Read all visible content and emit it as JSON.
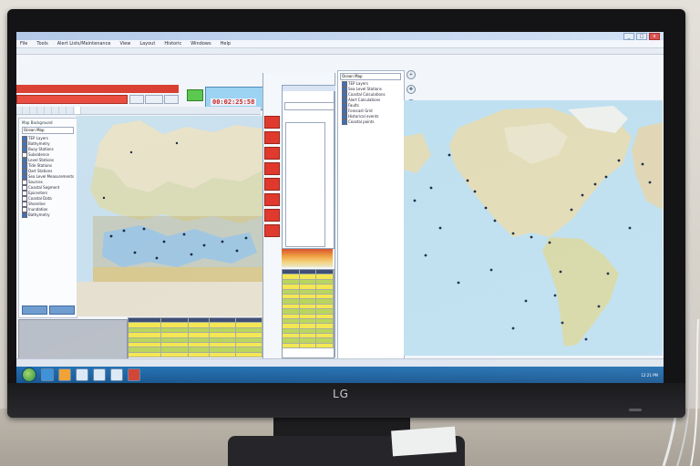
{
  "brand": {
    "label": "LG"
  },
  "window": {
    "buttons": {
      "min": "_",
      "max": "□",
      "close": "x"
    }
  },
  "menubar": {
    "items": [
      "File",
      "Tools",
      "Alert Lists/Maintenance",
      "View",
      "Layout",
      "Historic",
      "Windows",
      "Help"
    ]
  },
  "clock": {
    "time": "00:02:25:58"
  },
  "layers": {
    "title": "Map Background",
    "selected": "Ocean Map",
    "items": [
      {
        "label": "TEP Layers",
        "checked": true
      },
      {
        "label": "Bathymetry",
        "checked": true
      },
      {
        "label": "Buoy Stations",
        "checked": true
      },
      {
        "label": "Subsidence",
        "checked": false
      },
      {
        "label": "Level Stations",
        "checked": true
      },
      {
        "label": "Tide Stations",
        "checked": true
      },
      {
        "label": "Dart Stations",
        "checked": true
      },
      {
        "label": "Sea Level Measurements",
        "checked": true
      },
      {
        "label": "Sources",
        "checked": false
      },
      {
        "label": "Coastal Segment",
        "checked": false
      },
      {
        "label": "Epicenters",
        "checked": false
      },
      {
        "label": "Coastal Data",
        "checked": false
      },
      {
        "label": "Shoreline",
        "checked": false
      },
      {
        "label": "Inundation",
        "checked": false
      },
      {
        "label": "Bathymetry",
        "checked": true
      }
    ]
  },
  "world_layers": {
    "selected": "Ocean Map",
    "items": [
      {
        "label": "TEP Layers",
        "checked": true
      },
      {
        "label": "Sea Level Stations",
        "checked": true
      },
      {
        "label": "Coastal Calculations",
        "checked": true
      },
      {
        "label": "Alert Calculations",
        "checked": true
      },
      {
        "label": "Faults",
        "checked": true
      },
      {
        "label": "Forecast Grid",
        "checked": true
      },
      {
        "label": "Historical events",
        "checked": true
      },
      {
        "label": "Coastal points",
        "checked": true
      }
    ]
  },
  "taskbar": {
    "time": "12:21 PM"
  },
  "colors": {
    "accent_red": "#d93a2c",
    "accent_green": "#57c74a",
    "taskbar_blue": "#1f6fb2",
    "table_yellow": "#f4e64d",
    "table_green": "#b8d45a"
  },
  "icons": [
    "start-orb-icon",
    "folder-icon",
    "browser-icon",
    "app-icon",
    "zoom-icon",
    "pan-icon"
  ]
}
